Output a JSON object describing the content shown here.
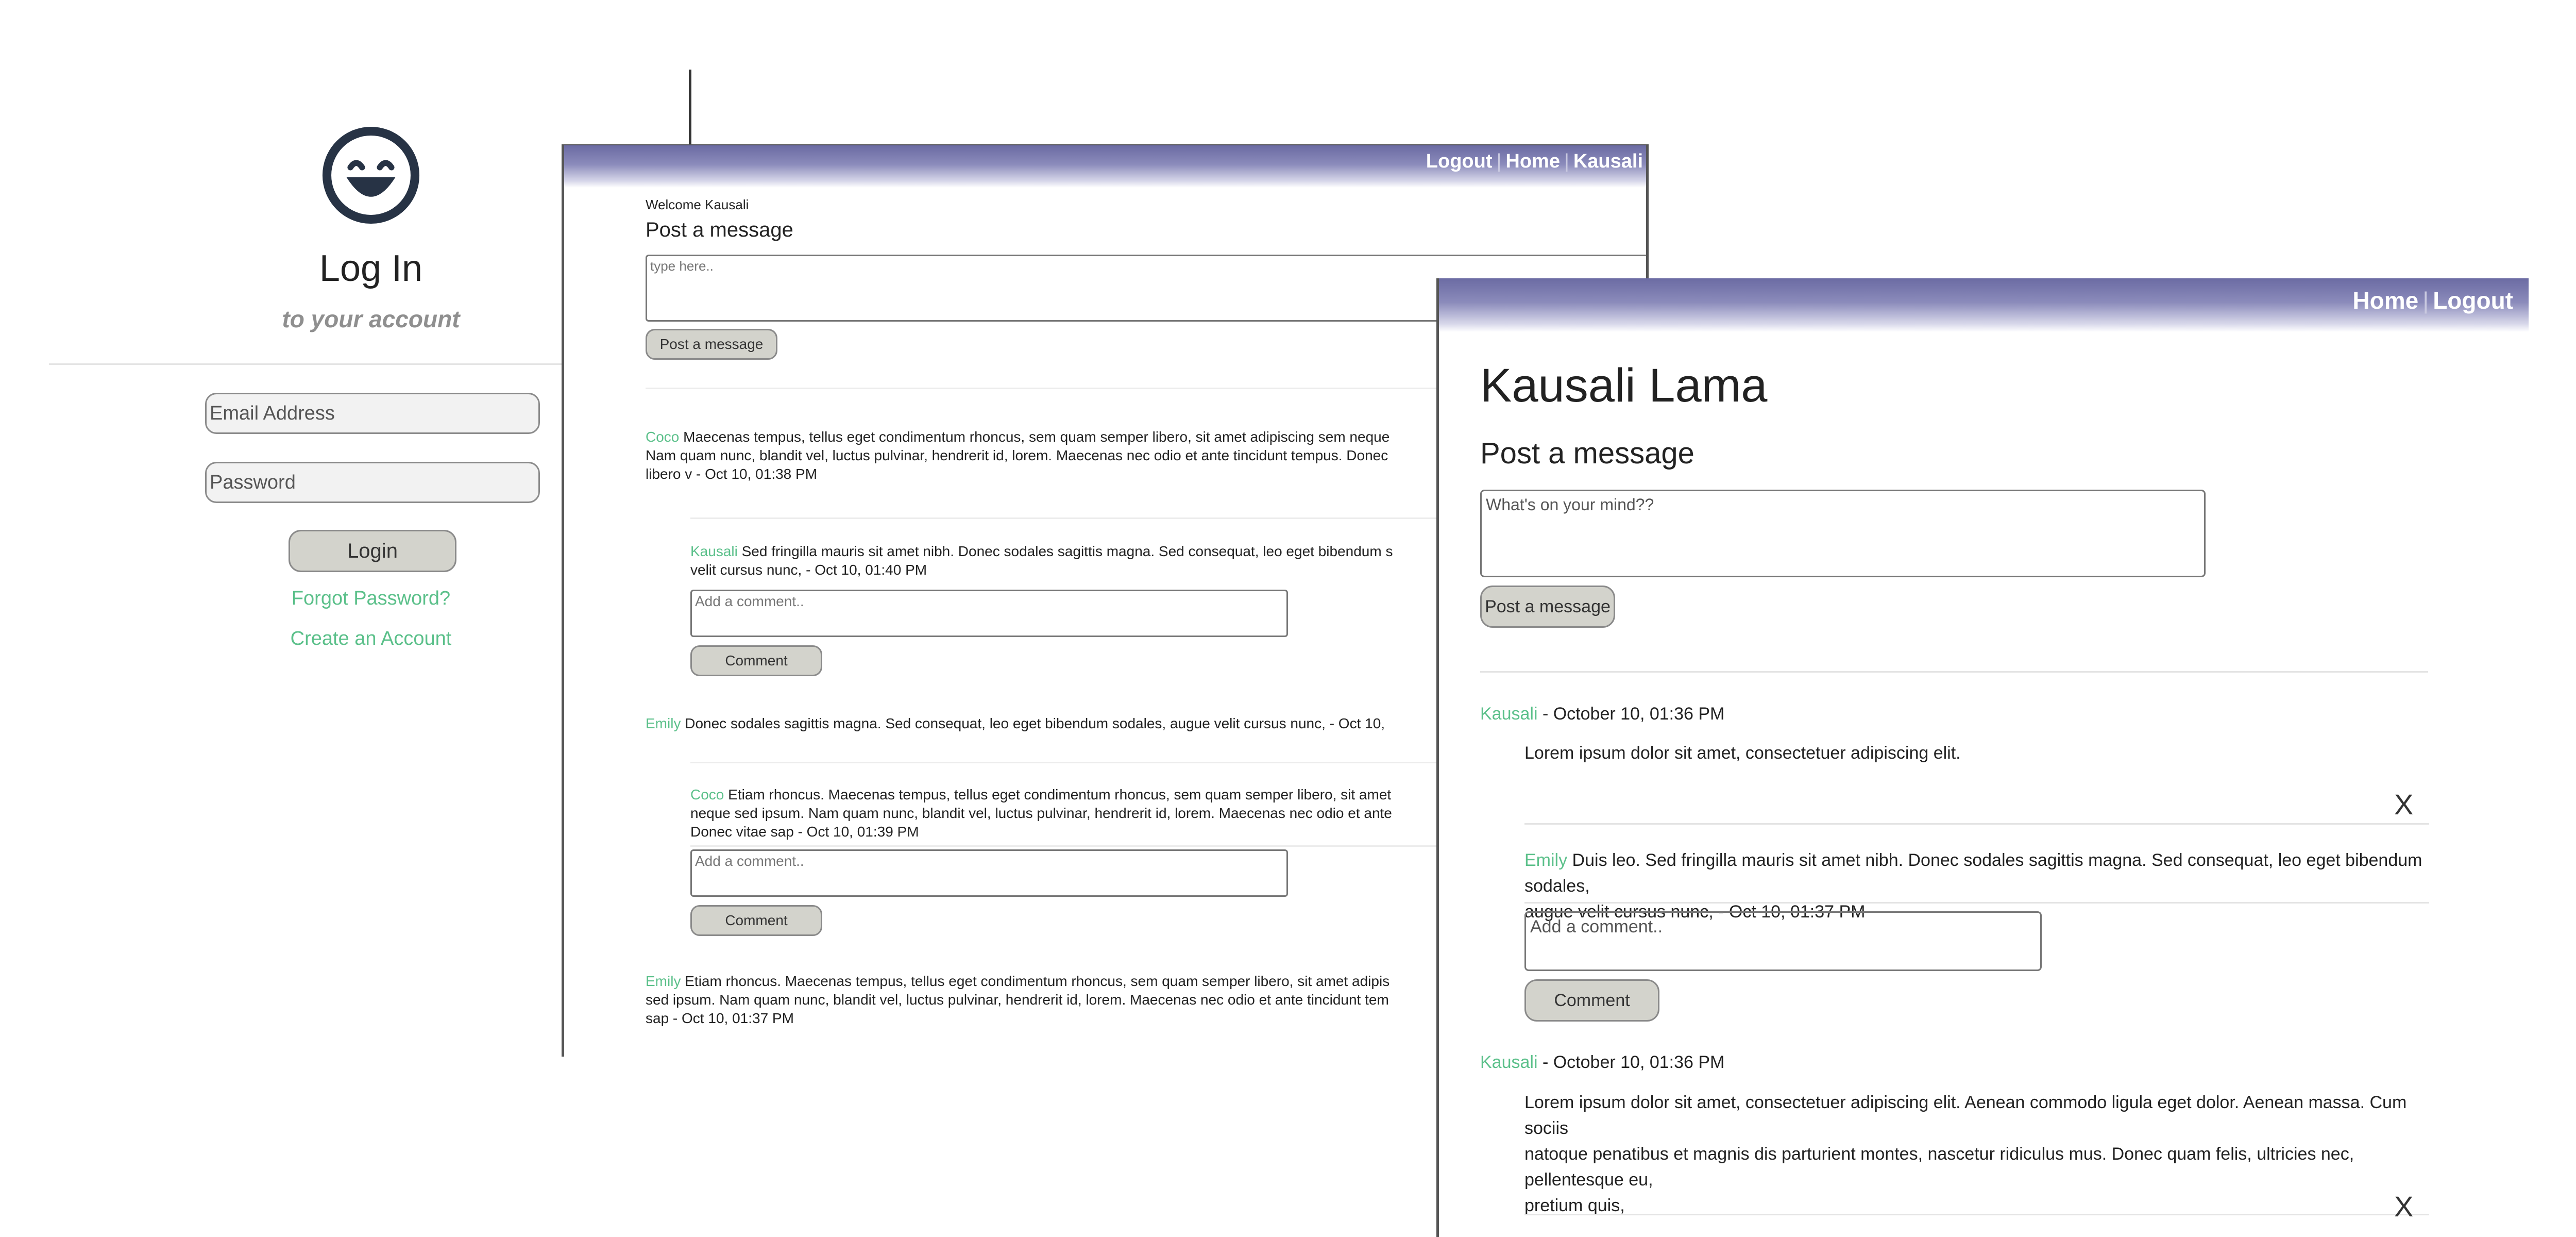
{
  "login": {
    "title": "Log In",
    "subtitle": "to your account",
    "email_placeholder": "Email Address",
    "password_placeholder": "Password",
    "login_button": "Login",
    "forgot_link": "Forgot Password?",
    "create_link": "Create an Account"
  },
  "window1": {
    "nav": {
      "logout": "Logout",
      "home": "Home",
      "user": "Kausali"
    },
    "welcome": "Welcome Kausali",
    "post_title": "Post a message",
    "textarea_placeholder": "type here..",
    "post_button": "Post a message",
    "comment_placeholder": "Add a comment..",
    "comment_button": "Comment",
    "messages": [
      {
        "author": "Coco",
        "lines": [
          " Maecenas tempus, tellus eget condimentum rhoncus, sem quam semper libero, sit amet adipiscing sem neque",
          "Nam quam nunc, blandit vel, luctus pulvinar, hendrerit id, lorem. Maecenas nec odio et ante tincidunt tempus. Donec",
          "libero v - Oct 10, 01:38 PM"
        ],
        "comment": {
          "author": "Kausali",
          "lines": [
            " Sed fringilla mauris sit amet nibh. Donec sodales sagittis magna. Sed consequat, leo eget bibendum s",
            "velit cursus nunc, - Oct 10, 01:40 PM"
          ]
        }
      },
      {
        "author": "Emily",
        "lines": [
          " Donec sodales sagittis magna. Sed consequat, leo eget bibendum sodales, augue velit cursus nunc, - Oct 10,"
        ],
        "comment": {
          "author": "Coco",
          "lines": [
            " Etiam rhoncus. Maecenas tempus, tellus eget condimentum rhoncus, sem quam semper libero, sit amet",
            "neque sed ipsum. Nam quam nunc, blandit vel, luctus pulvinar, hendrerit id, lorem. Maecenas nec odio et ante",
            "Donec vitae sap - Oct 10, 01:39 PM"
          ]
        }
      },
      {
        "author": "Emily",
        "lines": [
          " Etiam rhoncus. Maecenas tempus, tellus eget condimentum rhoncus, sem quam semper libero, sit amet adipis",
          "sed ipsum. Nam quam nunc, blandit vel, luctus pulvinar, hendrerit id, lorem. Maecenas nec odio et ante tincidunt tem",
          "sap - Oct 10, 01:37 PM"
        ]
      }
    ]
  },
  "window2": {
    "nav": {
      "home": "Home",
      "logout": "Logout"
    },
    "profile_name": "Kausali Lama",
    "post_title": "Post a message",
    "textarea_placeholder": "What's on your mind??",
    "post_button": "Post a message",
    "comment_placeholder": "Add a comment..",
    "comment_button": "Comment",
    "close_symbol": "X",
    "posts": [
      {
        "author": "Kausali",
        "timestamp": " - October 10, 01:36 PM",
        "lines": [
          "Lorem ipsum dolor sit amet, consectetuer adipiscing elit."
        ],
        "comment": {
          "author": "Emily",
          "lines": [
            " Duis leo. Sed fringilla mauris sit amet nibh. Donec sodales sagittis magna. Sed consequat, leo eget bibendum sodales,",
            "augue velit cursus nunc, - Oct 10, 01:37 PM"
          ]
        }
      },
      {
        "author": "Kausali",
        "timestamp": " - October 10, 01:36 PM",
        "lines": [
          "Lorem ipsum dolor sit amet, consectetuer adipiscing elit. Aenean commodo ligula eget dolor. Aenean massa. Cum sociis",
          "natoque penatibus et magnis dis parturient montes, nascetur ridiculus mus. Donec quam felis, ultricies nec, pellentesque eu,",
          "pretium quis,"
        ]
      }
    ]
  },
  "colors": {
    "username": "#5bc08a",
    "header_top": "#6b6ba3",
    "button_bg": "#d3d3cc"
  },
  "icons": {
    "logo": "smiley-face-icon",
    "close": "close-icon"
  }
}
